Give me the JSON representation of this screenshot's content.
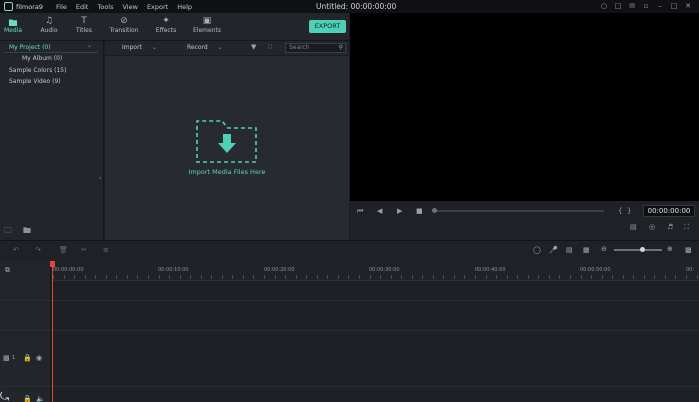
{
  "app": {
    "name": "filmora9",
    "document_title": "Untitled:  00:00:00:00"
  },
  "menu": [
    "File",
    "Edit",
    "Tools",
    "View",
    "Export",
    "Help"
  ],
  "window_icons": [
    "user-icon",
    "account-icon",
    "mail-icon",
    "notification-icon",
    "minimize-icon",
    "maximize-icon",
    "close-icon"
  ],
  "tabs": [
    {
      "label": "Media",
      "icon": "folder-icon",
      "active": true
    },
    {
      "label": "Audio",
      "icon": "music-note-icon",
      "active": false
    },
    {
      "label": "Titles",
      "icon": "text-icon",
      "active": false
    },
    {
      "label": "Transition",
      "icon": "transition-icon",
      "active": false
    },
    {
      "label": "Effects",
      "icon": "effects-icon",
      "active": false
    },
    {
      "label": "Elements",
      "icon": "image-icon",
      "active": false
    }
  ],
  "export_label": "EXPORT",
  "library": {
    "items": [
      {
        "label": "My Project (0)",
        "active": true
      },
      {
        "label": "My Album (0)",
        "active": false
      },
      {
        "label": "Sample Colors (15)",
        "active": false
      },
      {
        "label": "Sample Video (9)",
        "active": false
      }
    ]
  },
  "media_bar": {
    "import_label": "Import",
    "record_label": "Record",
    "search_placeholder": "Search"
  },
  "import_area": {
    "label": "Import Media Files Here"
  },
  "preview": {
    "timecode": "00:00:00:00",
    "progress": 0
  },
  "timeline": {
    "ruler_labels": [
      "00:00:00:00",
      "00:00:10:00",
      "00:00:20:00",
      "00:00:30:00",
      "00:00:40:00",
      "00:00:50:00",
      "00:"
    ],
    "video_track_number": "1"
  },
  "colors": {
    "accent": "#4fd0b6",
    "playhead": "#e4473a",
    "background": "#1b1e22"
  }
}
